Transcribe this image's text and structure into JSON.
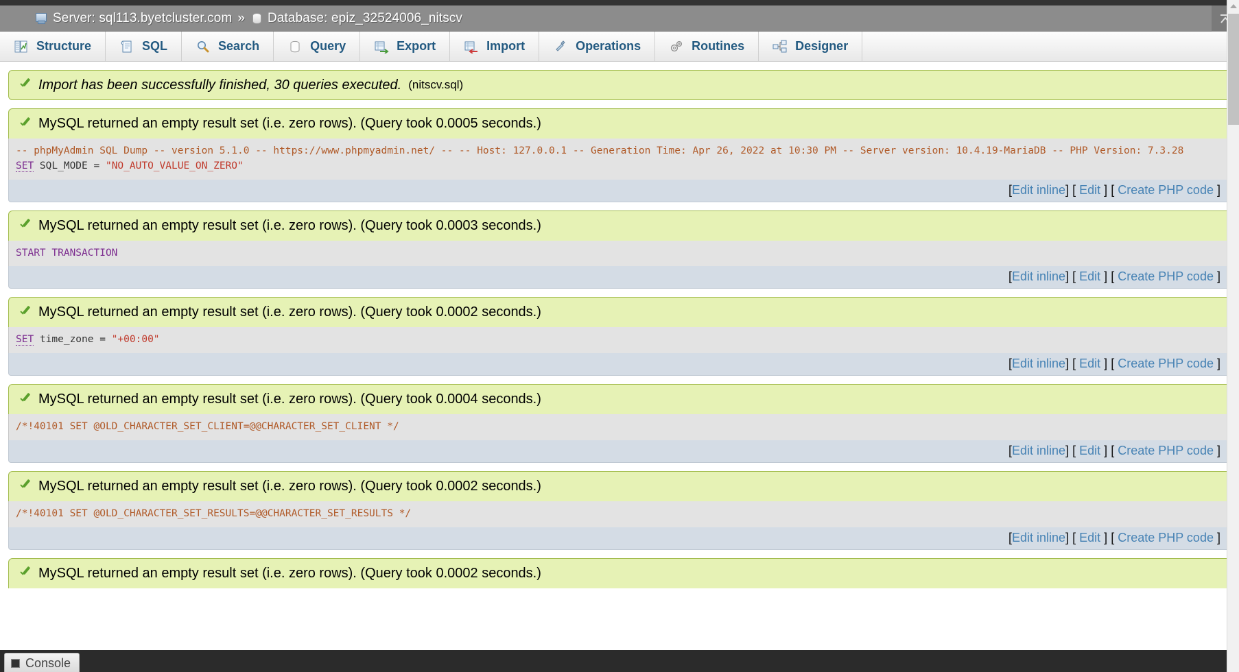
{
  "breadcrumb": {
    "server_icon": "server-icon",
    "server_label": "Server: sql113.byetcluster.com",
    "separator": "»",
    "database_icon": "database-icon",
    "database_label": "Database: epiz_32524006_nitscv",
    "collapse_icon": "⤒"
  },
  "tabs": [
    {
      "icon": "structure-icon",
      "label": "Structure"
    },
    {
      "icon": "sql-icon",
      "label": "SQL"
    },
    {
      "icon": "search-icon",
      "label": "Search"
    },
    {
      "icon": "query-icon",
      "label": "Query"
    },
    {
      "icon": "export-icon",
      "label": "Export"
    },
    {
      "icon": "import-icon",
      "label": "Import"
    },
    {
      "icon": "operations-icon",
      "label": "Operations"
    },
    {
      "icon": "routines-icon",
      "label": "Routines"
    },
    {
      "icon": "designer-icon",
      "label": "Designer"
    }
  ],
  "import_notice": {
    "message": "Import has been successfully finished, 30 queries executed.",
    "file": "(nitscv.sql)"
  },
  "actions": {
    "edit_inline": "Edit inline",
    "edit": "Edit",
    "create_php": "Create PHP code",
    "open_bracket": "[",
    "close_bracket": "]"
  },
  "results": [
    {
      "message": "MySQL returned an empty result set (i.e. zero rows). (Query took 0.0005 seconds.)",
      "sql_comment": "-- phpMyAdmin SQL Dump -- version 5.1.0 -- https://www.phpmyadmin.net/ -- -- Host: 127.0.0.1 -- Generation Time: Apr 26, 2022 at 10:30 PM -- Server version: 10.4.19-MariaDB -- PHP Version: 7.3.28",
      "sql_keyword": "SET",
      "sql_ident": " SQL_MODE = ",
      "sql_value": "\"NO_AUTO_VALUE_ON_ZERO\""
    },
    {
      "message": "MySQL returned an empty result set (i.e. zero rows). (Query took 0.0003 seconds.)",
      "sql_comment": "",
      "sql_keyword": "START TRANSACTION",
      "sql_ident": "",
      "sql_value": ""
    },
    {
      "message": "MySQL returned an empty result set (i.e. zero rows). (Query took 0.0002 seconds.)",
      "sql_comment": "",
      "sql_keyword": "SET",
      "sql_ident": " time_zone = ",
      "sql_value": "\"+00:00\""
    },
    {
      "message": "MySQL returned an empty result set (i.e. zero rows). (Query took 0.0004 seconds.)",
      "sql_comment": "/*!40101 SET @OLD_CHARACTER_SET_CLIENT=@@CHARACTER_SET_CLIENT */",
      "sql_keyword": "",
      "sql_ident": "",
      "sql_value": ""
    },
    {
      "message": "MySQL returned an empty result set (i.e. zero rows). (Query took 0.0002 seconds.)",
      "sql_comment": "/*!40101 SET @OLD_CHARACTER_SET_RESULTS=@@CHARACTER_SET_RESULTS */",
      "sql_keyword": "",
      "sql_ident": "",
      "sql_value": ""
    },
    {
      "message": "MySQL returned an empty result set (i.e. zero rows). (Query took 0.0002 seconds.)",
      "sql_comment": "",
      "sql_keyword": "",
      "sql_ident": "",
      "sql_value": ""
    }
  ],
  "console": {
    "label": "Console",
    "icon": "console-icon"
  },
  "colors": {
    "message_bg": "#e6f2b5",
    "message_border": "#a2bc4c",
    "sql_bg": "#e3e3e3",
    "actions_bg": "#d4dce5",
    "link": "#4682b4",
    "tab_label": "#235a81",
    "breadcrumb_bg": "#8c8c8c",
    "console_bg": "#2b2b2b"
  }
}
